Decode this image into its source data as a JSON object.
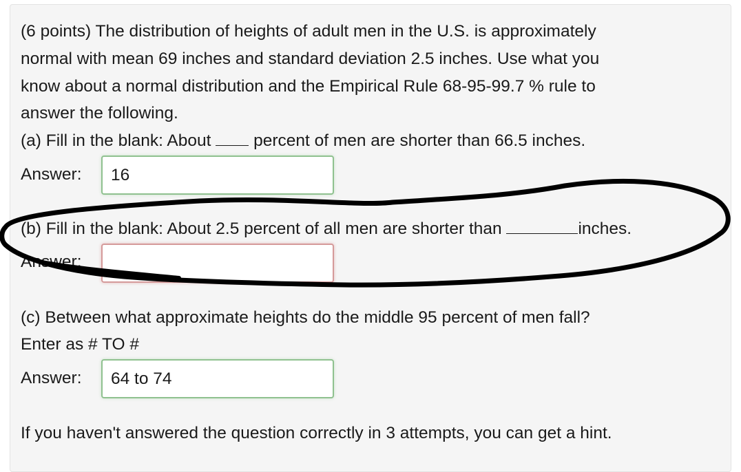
{
  "question": {
    "intro_lines": [
      "(6 points) The distribution of heights of adult men in the U.S. is approximately",
      "normal with mean 69 inches and standard deviation 2.5 inches. Use what you",
      "know about a normal distribution and the Empirical Rule 68-95-99.7 % rule to",
      "answer the following."
    ],
    "part_a": {
      "prefix": "(a) Fill in the blank: About ",
      "suffix": " percent of men are shorter than 66.5 inches.",
      "answer_label": "Answer:",
      "answer_value": "16",
      "status": "correct"
    },
    "part_b": {
      "prefix": "(b) Fill in the blank: About 2.5 percent of all men are shorter than ",
      "suffix": "inches.",
      "answer_label": "Answer:",
      "answer_value": "",
      "status": "incorrect"
    },
    "part_c": {
      "line1": "(c) Between what approximate heights do the middle 95 percent of men fall?",
      "line2": "Enter as # TO #",
      "answer_label": "Answer:",
      "answer_value": "64 to 74",
      "status": "correct"
    },
    "hint_text": "If you haven't answered the question correctly in 3 attempts, you can get a hint."
  },
  "colors": {
    "panel_bg": "#f5f5f5",
    "correct_border": "#8fc18f",
    "incorrect_border": "#d59a9a",
    "scribble": "#000000"
  }
}
